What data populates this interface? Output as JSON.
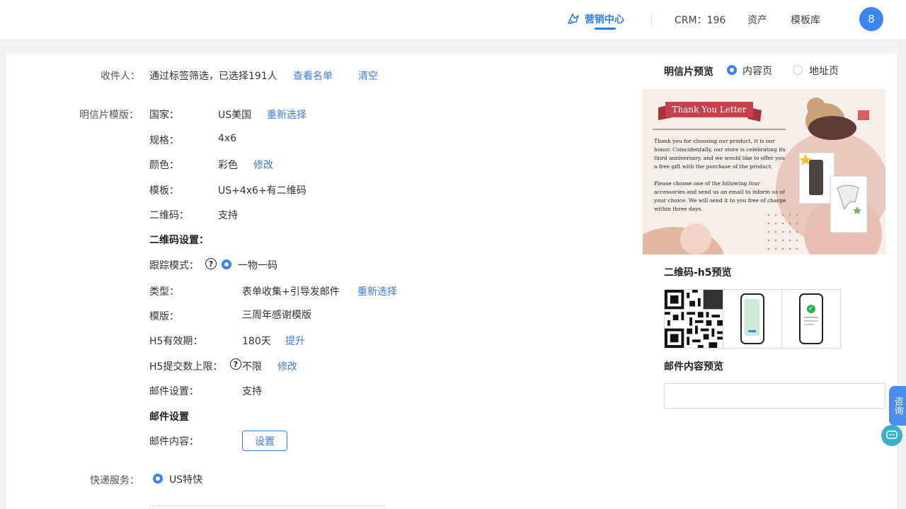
{
  "topbar": {
    "nav_active": "营销中心",
    "crm": "CRM：196",
    "assets": "资产",
    "templates": "模板库",
    "avatar": "8"
  },
  "recipient": {
    "label": "收件人：",
    "text": "通过标签筛选，已选择191人",
    "view_list": "查看名单",
    "clear": "清空"
  },
  "template": {
    "label": "明信片模版：",
    "country_label": "国家：",
    "country_value": "US美国",
    "reselect": "重新选择",
    "spec_label": "规格：",
    "spec_value": "4x6",
    "color_label": "颜色：",
    "color_value": "彩色",
    "color_edit": "修改",
    "tpl_label": "模板：",
    "tpl_value": "US+4x6+有二维码",
    "qr_label": "二维码：",
    "qr_value": "支持"
  },
  "qr_settings": {
    "title": "二维码设置：",
    "tracking_label": "跟踪模式：",
    "tracking_value": "一物一码",
    "type_label": "类型：",
    "type_value": "表单收集+引导发邮件",
    "type_reselect": "重新选择",
    "layout_label": "模版：",
    "layout_value": "三周年感谢模版",
    "h5_valid_label": "H5有效期：",
    "h5_valid_value": "180天",
    "h5_valid_upgrade": "提升",
    "h5_limit_label": "H5提交数上限：",
    "h5_limit_value": "不限",
    "h5_limit_edit": "修改",
    "mail_setting_label": "邮件设置：",
    "mail_setting_value": "支持"
  },
  "mail_settings": {
    "title": "邮件设置",
    "content_label": "邮件内容：",
    "set_button": "设置"
  },
  "shipping": {
    "label": "快递服务：",
    "value": "US特快"
  },
  "preview": {
    "title": "明信片预览",
    "opt_content": "内容页",
    "opt_address": "地址页",
    "banner": "Thank You Letter",
    "para1": "Thank you for choosing our product, it is our honor. Coincidentally, our store is celebrating its third anniversary, and we would like to offer you a free gift with the purchase of the product.",
    "para2": "Please choose one of the following four accessories and send us an email to inform us of your choice. We will send it to you free of charge within three days.",
    "qr_title": "二维码-h5预览",
    "mail_title": "邮件内容预览"
  },
  "side": {
    "consult": "咨询"
  },
  "colors": {
    "accent": "#3c7be3",
    "avatar": "#3b86f2",
    "postcard_bg": "#f6efe9",
    "banner_red": "#c8414a"
  }
}
